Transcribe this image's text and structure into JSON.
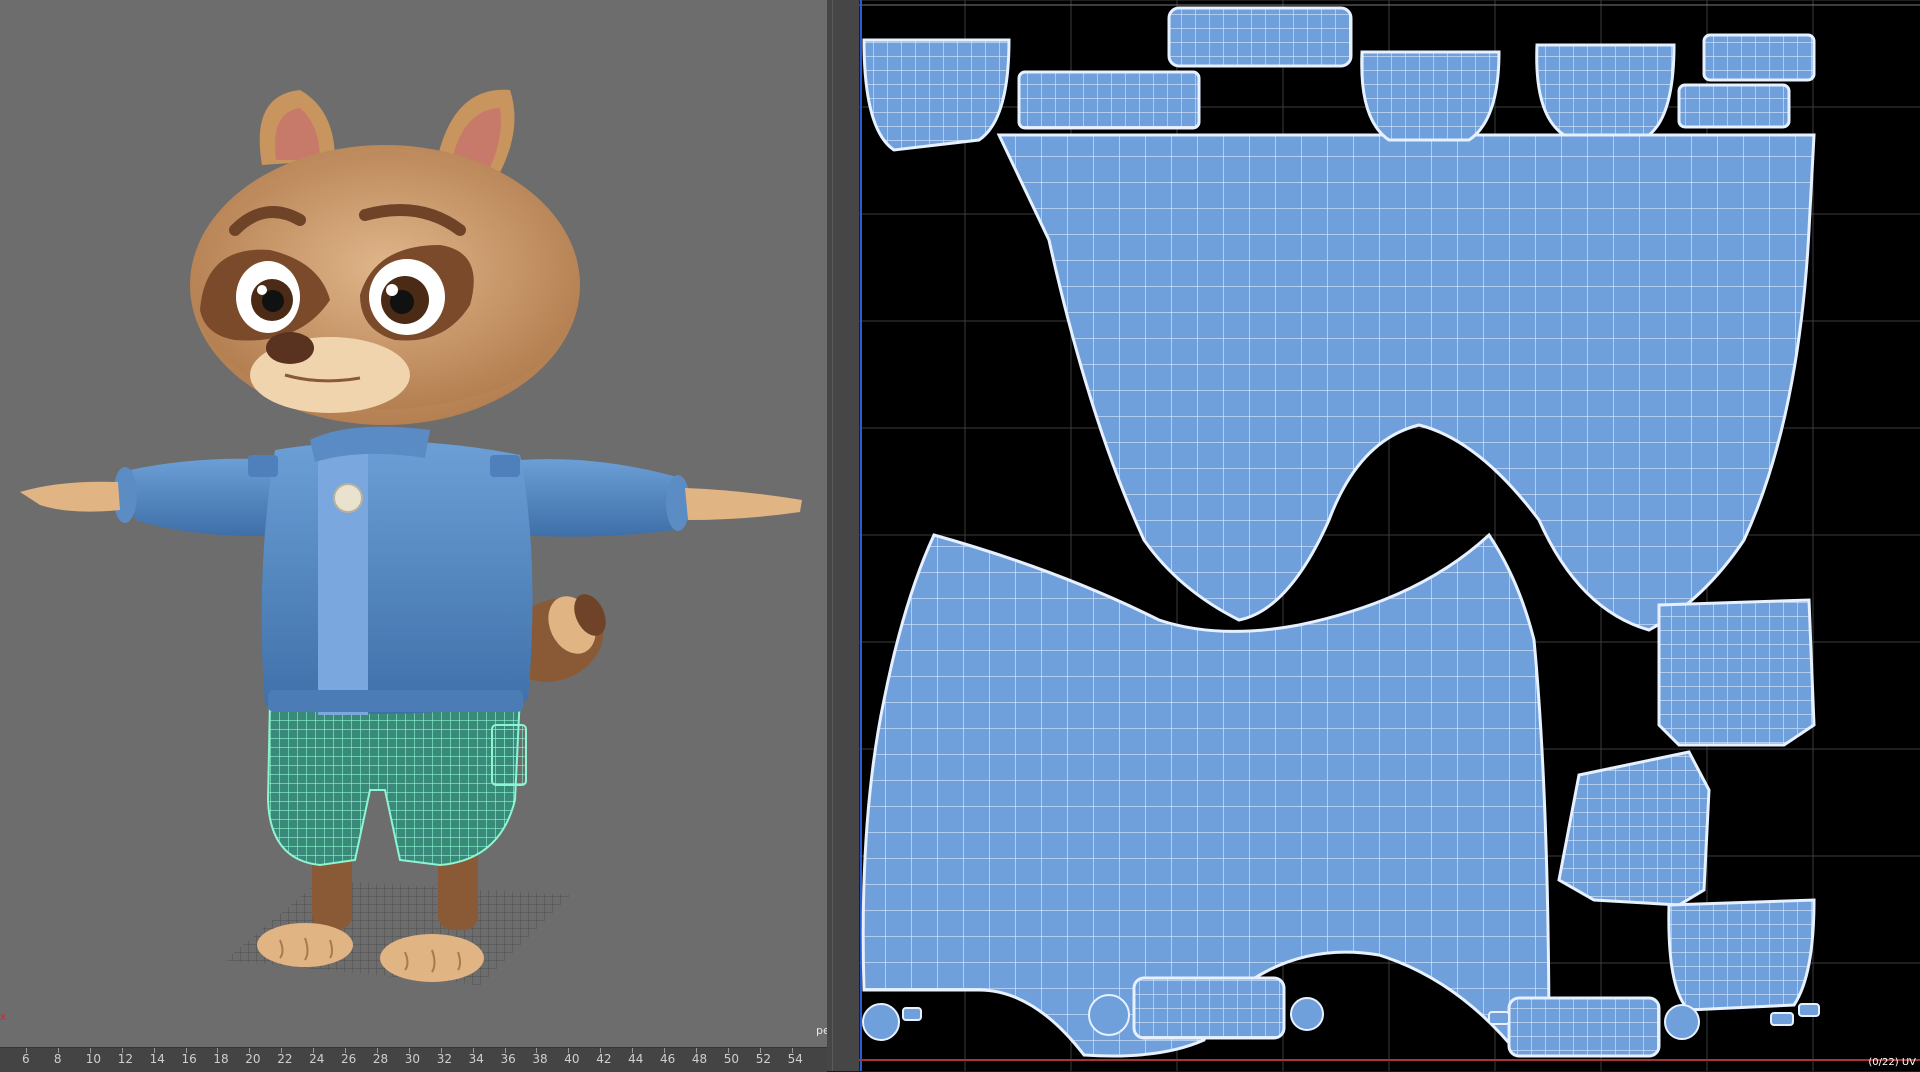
{
  "viewport": {
    "camera_label": "pe",
    "origin_marker": "x"
  },
  "timeline": {
    "ticks": [
      "6",
      "8",
      "10",
      "12",
      "14",
      "16",
      "18",
      "20",
      "22",
      "24",
      "26",
      "28",
      "30",
      "32",
      "34",
      "36",
      "38",
      "40",
      "42",
      "44",
      "46",
      "48",
      "50",
      "52",
      "54"
    ]
  },
  "uv_editor": {
    "status_text": "(0/22) UV"
  },
  "colors": {
    "viewport_bg": "#6d6d6d",
    "uv_bg": "#000000",
    "uv_shell_fill": "#6fa0db",
    "uv_wire": "#ffffff",
    "mesh_select": "#6cf0c6"
  }
}
